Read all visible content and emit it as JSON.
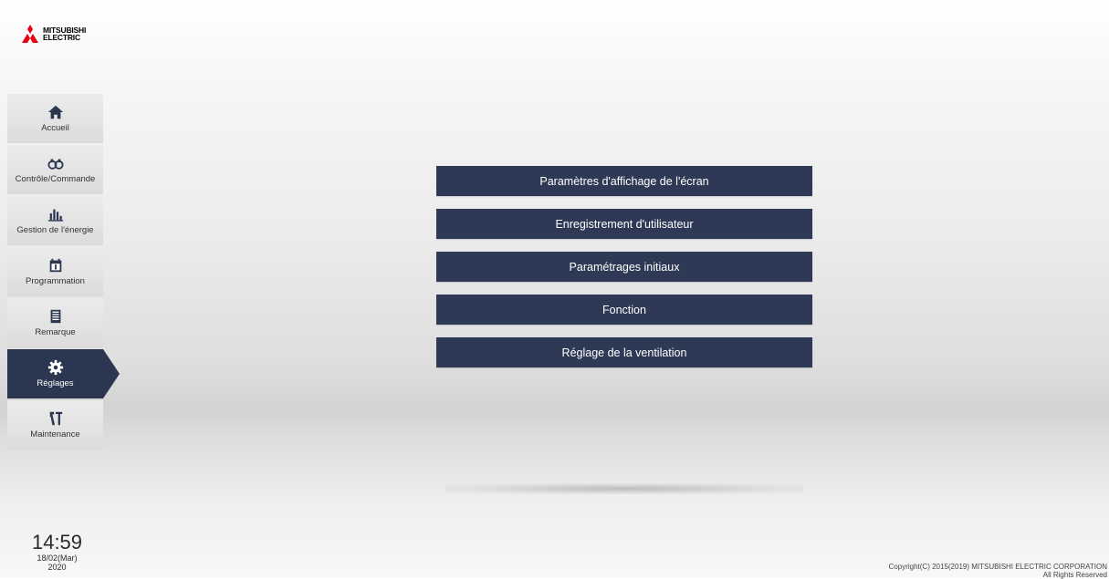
{
  "brand": {
    "line1": "MITSUBISHI",
    "line2": "ELECTRIC",
    "logo_color": "#e60012"
  },
  "sidebar": {
    "items": [
      {
        "label": "Accueil",
        "icon": "home-icon",
        "active": false
      },
      {
        "label": "Contrôle/Commande",
        "icon": "binoculars-icon",
        "active": false
      },
      {
        "label": "Gestion de l'énergie",
        "icon": "bar-chart-icon",
        "active": false
      },
      {
        "label": "Programmation",
        "icon": "calendar-icon",
        "active": false
      },
      {
        "label": "Remarque",
        "icon": "notes-icon",
        "active": false
      },
      {
        "label": "Réglages",
        "icon": "gear-icon",
        "active": true
      },
      {
        "label": "Maintenance",
        "icon": "tools-icon",
        "active": false
      }
    ]
  },
  "menu": {
    "items": [
      "Paramètres d'affichage de l'écran",
      "Enregistrement d'utilisateur",
      "Paramétrages initiaux",
      "Fonction",
      "Réglage de la ventilation"
    ]
  },
  "clock": {
    "time": "14:59",
    "date": "18/02(Mar)",
    "year": "2020"
  },
  "footer": {
    "copyright": "Copyright(C) 2015(2019) MITSUBISHI ELECTRIC CORPORATION",
    "rights": "All Rights Reserved"
  },
  "colors": {
    "accent": "#2e3a55",
    "active_nav": "#2b3650"
  }
}
